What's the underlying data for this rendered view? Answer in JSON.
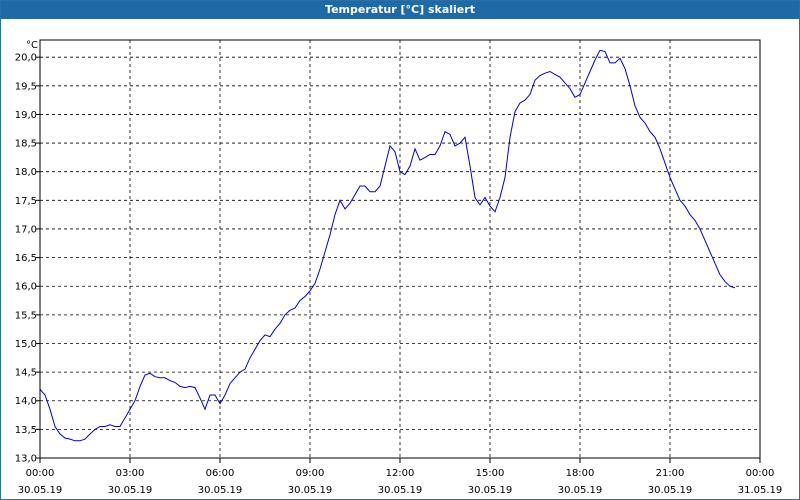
{
  "window": {
    "title": "Temperatur [°C] skaliert"
  },
  "chart_data": {
    "type": "line",
    "title": "Temperatur [°C] skaliert",
    "ylabel": "°C",
    "xlabel": "",
    "ylim": [
      13.0,
      20.3
    ],
    "grid": true,
    "y_ticks": [
      "13,0",
      "13,5",
      "14,0",
      "14,5",
      "15,0",
      "15,5",
      "16,0",
      "16,5",
      "17,0",
      "17,5",
      "18,0",
      "18,5",
      "19,0",
      "19,5",
      "20,0"
    ],
    "x_ticks": [
      {
        "time": "00:00",
        "date": "30.05.19"
      },
      {
        "time": "03:00",
        "date": "30.05.19"
      },
      {
        "time": "06:00",
        "date": "30.05.19"
      },
      {
        "time": "09:00",
        "date": "30.05.19"
      },
      {
        "time": "12:00",
        "date": "30.05.19"
      },
      {
        "time": "15:00",
        "date": "30.05.19"
      },
      {
        "time": "18:00",
        "date": "30.05.19"
      },
      {
        "time": "21:00",
        "date": "30.05.19"
      },
      {
        "time": "00:00",
        "date": "31.05.19"
      }
    ],
    "series": [
      {
        "color": "#0000cc",
        "points": [
          [
            "30.05.19 00:00",
            14.2
          ],
          [
            "30.05.19 00:10",
            14.1
          ],
          [
            "30.05.19 00:20",
            13.85
          ],
          [
            "30.05.19 00:30",
            13.55
          ],
          [
            "30.05.19 00:40",
            13.42
          ],
          [
            "30.05.19 00:50",
            13.35
          ],
          [
            "30.05.19 01:00",
            13.33
          ],
          [
            "30.05.19 01:10",
            13.3
          ],
          [
            "30.05.19 01:20",
            13.3
          ],
          [
            "30.05.19 01:30",
            13.33
          ],
          [
            "30.05.19 01:40",
            13.42
          ],
          [
            "30.05.19 01:50",
            13.5
          ],
          [
            "30.05.19 02:00",
            13.55
          ],
          [
            "30.05.19 02:10",
            13.55
          ],
          [
            "30.05.19 02:20",
            13.58
          ],
          [
            "30.05.19 02:30",
            13.55
          ],
          [
            "30.05.19 02:40",
            13.55
          ],
          [
            "30.05.19 02:50",
            13.7
          ],
          [
            "30.05.19 03:00",
            13.85
          ],
          [
            "30.05.19 03:10",
            14.0
          ],
          [
            "30.05.19 03:20",
            14.25
          ],
          [
            "30.05.19 03:30",
            14.45
          ],
          [
            "30.05.19 03:40",
            14.48
          ],
          [
            "30.05.19 03:50",
            14.42
          ],
          [
            "30.05.19 04:00",
            14.4
          ],
          [
            "30.05.19 04:10",
            14.4
          ],
          [
            "30.05.19 04:20",
            14.35
          ],
          [
            "30.05.19 04:30",
            14.32
          ],
          [
            "30.05.19 04:40",
            14.25
          ],
          [
            "30.05.19 04:50",
            14.23
          ],
          [
            "30.05.19 05:00",
            14.25
          ],
          [
            "30.05.19 05:10",
            14.23
          ],
          [
            "30.05.19 05:20",
            14.05
          ],
          [
            "30.05.19 05:30",
            13.85
          ],
          [
            "30.05.19 05:40",
            14.1
          ],
          [
            "30.05.19 05:50",
            14.1
          ],
          [
            "30.05.19 06:00",
            13.95
          ],
          [
            "30.05.19 06:10",
            14.1
          ],
          [
            "30.05.19 06:20",
            14.3
          ],
          [
            "30.05.19 06:30",
            14.4
          ],
          [
            "30.05.19 06:40",
            14.5
          ],
          [
            "30.05.19 06:50",
            14.55
          ],
          [
            "30.05.19 07:00",
            14.75
          ],
          [
            "30.05.19 07:10",
            14.9
          ],
          [
            "30.05.19 07:20",
            15.05
          ],
          [
            "30.05.19 07:30",
            15.15
          ],
          [
            "30.05.19 07:40",
            15.12
          ],
          [
            "30.05.19 07:50",
            15.25
          ],
          [
            "30.05.19 08:00",
            15.35
          ],
          [
            "30.05.19 08:10",
            15.5
          ],
          [
            "30.05.19 08:20",
            15.58
          ],
          [
            "30.05.19 08:30",
            15.62
          ],
          [
            "30.05.19 08:40",
            15.75
          ],
          [
            "30.05.19 08:50",
            15.82
          ],
          [
            "30.05.19 09:00",
            15.92
          ],
          [
            "30.05.19 09:10",
            16.05
          ],
          [
            "30.05.19 09:20",
            16.3
          ],
          [
            "30.05.19 09:30",
            16.6
          ],
          [
            "30.05.19 09:40",
            16.9
          ],
          [
            "30.05.19 09:50",
            17.25
          ],
          [
            "30.05.19 10:00",
            17.5
          ],
          [
            "30.05.19 10:10",
            17.35
          ],
          [
            "30.05.19 10:20",
            17.45
          ],
          [
            "30.05.19 10:30",
            17.6
          ],
          [
            "30.05.19 10:40",
            17.75
          ],
          [
            "30.05.19 10:50",
            17.75
          ],
          [
            "30.05.19 11:00",
            17.65
          ],
          [
            "30.05.19 11:10",
            17.65
          ],
          [
            "30.05.19 11:20",
            17.75
          ],
          [
            "30.05.19 11:30",
            18.1
          ],
          [
            "30.05.19 11:40",
            18.45
          ],
          [
            "30.05.19 11:50",
            18.35
          ],
          [
            "30.05.19 12:00",
            18.0
          ],
          [
            "30.05.19 12:10",
            17.95
          ],
          [
            "30.05.19 12:20",
            18.1
          ],
          [
            "30.05.19 12:30",
            18.4
          ],
          [
            "30.05.19 12:40",
            18.2
          ],
          [
            "30.05.19 12:50",
            18.25
          ],
          [
            "30.05.19 13:00",
            18.3
          ],
          [
            "30.05.19 13:10",
            18.3
          ],
          [
            "30.05.19 13:20",
            18.45
          ],
          [
            "30.05.19 13:30",
            18.7
          ],
          [
            "30.05.19 13:40",
            18.65
          ],
          [
            "30.05.19 13:50",
            18.45
          ],
          [
            "30.05.19 14:00",
            18.5
          ],
          [
            "30.05.19 14:10",
            18.6
          ],
          [
            "30.05.19 14:20",
            18.1
          ],
          [
            "30.05.19 14:30",
            17.55
          ],
          [
            "30.05.19 14:40",
            17.42
          ],
          [
            "30.05.19 14:50",
            17.55
          ],
          [
            "30.05.19 15:00",
            17.4
          ],
          [
            "30.05.19 15:10",
            17.3
          ],
          [
            "30.05.19 15:20",
            17.55
          ],
          [
            "30.05.19 15:30",
            17.9
          ],
          [
            "30.05.19 15:40",
            18.6
          ],
          [
            "30.05.19 15:50",
            19.05
          ],
          [
            "30.05.19 16:00",
            19.2
          ],
          [
            "30.05.19 16:10",
            19.25
          ],
          [
            "30.05.19 16:20",
            19.35
          ],
          [
            "30.05.19 16:30",
            19.6
          ],
          [
            "30.05.19 16:40",
            19.68
          ],
          [
            "30.05.19 16:50",
            19.72
          ],
          [
            "30.05.19 17:00",
            19.75
          ],
          [
            "30.05.19 17:10",
            19.7
          ],
          [
            "30.05.19 17:20",
            19.65
          ],
          [
            "30.05.19 17:30",
            19.55
          ],
          [
            "30.05.19 17:40",
            19.45
          ],
          [
            "30.05.19 17:50",
            19.3
          ],
          [
            "30.05.19 18:00",
            19.35
          ],
          [
            "30.05.19 18:10",
            19.55
          ],
          [
            "30.05.19 18:20",
            19.75
          ],
          [
            "30.05.19 18:30",
            19.95
          ],
          [
            "30.05.19 18:40",
            20.12
          ],
          [
            "30.05.19 18:50",
            20.1
          ],
          [
            "30.05.19 19:00",
            19.9
          ],
          [
            "30.05.19 19:10",
            19.9
          ],
          [
            "30.05.19 19:20",
            19.98
          ],
          [
            "30.05.19 19:30",
            19.8
          ],
          [
            "30.05.19 19:40",
            19.5
          ],
          [
            "30.05.19 19:50",
            19.15
          ],
          [
            "30.05.19 20:00",
            18.95
          ],
          [
            "30.05.19 20:10",
            18.85
          ],
          [
            "30.05.19 20:20",
            18.7
          ],
          [
            "30.05.19 20:30",
            18.6
          ],
          [
            "30.05.19 20:40",
            18.4
          ],
          [
            "30.05.19 20:50",
            18.15
          ],
          [
            "30.05.19 21:00",
            17.9
          ],
          [
            "30.05.19 21:10",
            17.7
          ],
          [
            "30.05.19 21:20",
            17.5
          ],
          [
            "30.05.19 21:30",
            17.4
          ],
          [
            "30.05.19 21:40",
            17.25
          ],
          [
            "30.05.19 21:50",
            17.15
          ],
          [
            "30.05.19 22:00",
            17.0
          ],
          [
            "30.05.19 22:10",
            16.8
          ],
          [
            "30.05.19 22:20",
            16.6
          ],
          [
            "30.05.19 22:30",
            16.4
          ],
          [
            "30.05.19 22:40",
            16.2
          ],
          [
            "30.05.19 22:50",
            16.08
          ],
          [
            "30.05.19 23:00",
            16.0
          ],
          [
            "30.05.19 23:10",
            15.97
          ]
        ]
      }
    ]
  }
}
